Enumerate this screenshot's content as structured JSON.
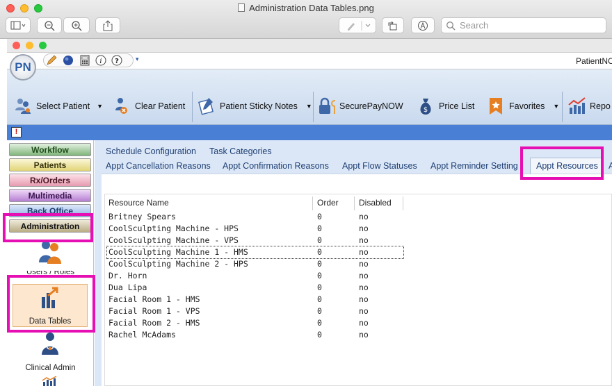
{
  "window": {
    "title": "Administration Data Tables.png",
    "search_placeholder": "Search"
  },
  "app": {
    "header_right": "PatientNO"
  },
  "ribbon": {
    "select_patient": "Select Patient",
    "clear_patient": "Clear Patient",
    "sticky_notes": "Patient Sticky Notes",
    "securepay": "SecurePayNOW",
    "price_list": "Price List",
    "favorites": "Favorites",
    "reports": "Repo"
  },
  "sidebar": {
    "tabs": [
      "Workflow",
      "Patients",
      "Rx/Orders",
      "Multimedia",
      "Back Office",
      "Administration"
    ],
    "users_roles": "Users / Roles",
    "data_tables": "Data Tables",
    "clinical_admin": "Clinical Admin"
  },
  "tabs_row1": [
    "Schedule Configuration",
    "Task Categories"
  ],
  "tabs_row2": [
    "Appt Cancellation Reasons",
    "Appt Confirmation Reasons",
    "Appt Flow Statuses",
    "Appt Reminder Setting",
    "Appt Resources",
    "A"
  ],
  "table": {
    "headers": [
      "Resource Name",
      "Order",
      "Disabled"
    ],
    "rows": [
      [
        "Britney Spears",
        "0",
        "no"
      ],
      [
        "CoolSculpting Machine - HPS",
        "0",
        "no"
      ],
      [
        "CoolSculpting Machine - VPS",
        "0",
        "no"
      ],
      [
        "CoolSculpting Machine 1 - HMS",
        "0",
        "no"
      ],
      [
        "CoolSculpting Machine 2 - HPS",
        "0",
        "no"
      ],
      [
        "Dr. Horn",
        "0",
        "no"
      ],
      [
        "Dua Lipa",
        "0",
        "no"
      ],
      [
        "Facial Room 1 - HMS",
        "0",
        "no"
      ],
      [
        "Facial Room 1 - VPS",
        "0",
        "no"
      ],
      [
        "Facial Room 2 - HMS",
        "0",
        "no"
      ],
      [
        "Rachel McAdams",
        "0",
        "no"
      ]
    ]
  },
  "colors": {
    "highlight": "#e60fb3",
    "alert_bar": "#4a7fd6",
    "tab_text": "#1f3f74"
  }
}
